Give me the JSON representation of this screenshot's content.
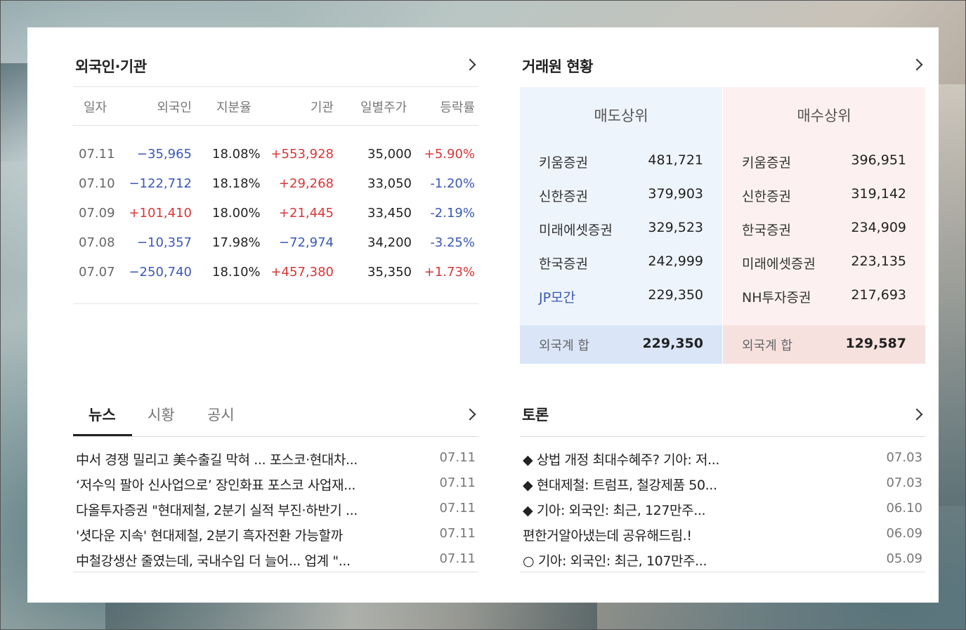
{
  "foreign_inst": {
    "title": "외국인·기관",
    "headers": [
      "일자",
      "외국인",
      "지분율",
      "기관",
      "일별주가",
      "등락률"
    ],
    "rows": [
      {
        "date": "07.11",
        "foreign": "−35,965",
        "ratio": "18.08%",
        "inst": "+553,928",
        "price": "35,000",
        "change": "+5.90%"
      },
      {
        "date": "07.10",
        "foreign": "−122,712",
        "ratio": "18.18%",
        "inst": "+29,268",
        "price": "33,050",
        "change": "-1.20%"
      },
      {
        "date": "07.09",
        "foreign": "+101,410",
        "ratio": "18.00%",
        "inst": "+21,445",
        "price": "33,450",
        "change": "-2.19%"
      },
      {
        "date": "07.08",
        "foreign": "−10,357",
        "ratio": "17.98%",
        "inst": "−72,974",
        "price": "34,200",
        "change": "-3.25%"
      },
      {
        "date": "07.07",
        "foreign": "−250,740",
        "ratio": "18.10%",
        "inst": "+457,380",
        "price": "35,350",
        "change": "+1.73%"
      }
    ]
  },
  "broker": {
    "title": "거래원 현황",
    "sell": {
      "title": "매도상위",
      "rows": [
        {
          "name": "키움증권",
          "value": "481,721"
        },
        {
          "name": "신한증권",
          "value": "379,903"
        },
        {
          "name": "미래에셋증권",
          "value": "329,523"
        },
        {
          "name": "한국증권",
          "value": "242,999"
        },
        {
          "name": "JP모간",
          "value": "229,350"
        }
      ],
      "total_label": "외국계 합",
      "total_value": "229,350"
    },
    "buy": {
      "title": "매수상위",
      "rows": [
        {
          "name": "키움증권",
          "value": "396,951"
        },
        {
          "name": "신한증권",
          "value": "319,142"
        },
        {
          "name": "한국증권",
          "value": "234,909"
        },
        {
          "name": "미래에셋증권",
          "value": "223,135"
        },
        {
          "name": "NH투자증권",
          "value": "217,693"
        }
      ],
      "total_label": "외국계 합",
      "total_value": "129,587"
    }
  },
  "news": {
    "tabs": [
      "뉴스",
      "시황",
      "공시"
    ],
    "items": [
      {
        "title": "中서 경쟁 밀리고 美수출길 막혀 ... 포스코·현대차...",
        "date": "07.11"
      },
      {
        "title": "‘저수익 팔아 신사업으로’ 장인화표 포스코 사업재...",
        "date": "07.11"
      },
      {
        "title": "다올투자증권 \"현대제철, 2분기 실적 부진·하반기 ...",
        "date": "07.11"
      },
      {
        "title": "'셧다운 지속' 현대제철, 2분기 흑자전환 가능할까",
        "date": "07.11"
      },
      {
        "title": "中철강생산 줄였는데, 국내수입 더 늘어... 업계 \"...",
        "date": "07.11"
      }
    ]
  },
  "discussion": {
    "title": "토론",
    "items": [
      {
        "title": "◆ 상법 개정 최대수혜주? 기아: 저...",
        "date": "07.03"
      },
      {
        "title": "◆ 현대제철: 트럼프, 철강제품 50...",
        "date": "07.03"
      },
      {
        "title": "◆ 기아: 외국인: 최근, 127만주...",
        "date": "06.10"
      },
      {
        "title": "편한거알아냈는데 공유해드림.!",
        "date": "06.09"
      },
      {
        "title": "○ 기아: 외국인: 최근, 107만주...",
        "date": "05.09"
      }
    ]
  },
  "colors": {
    "up": "#d93636",
    "down": "#3a58b8",
    "sell_bg": "#eef4fc",
    "buy_bg": "#fcf1f0"
  },
  "icons": [
    "chevron-right-icon"
  ]
}
